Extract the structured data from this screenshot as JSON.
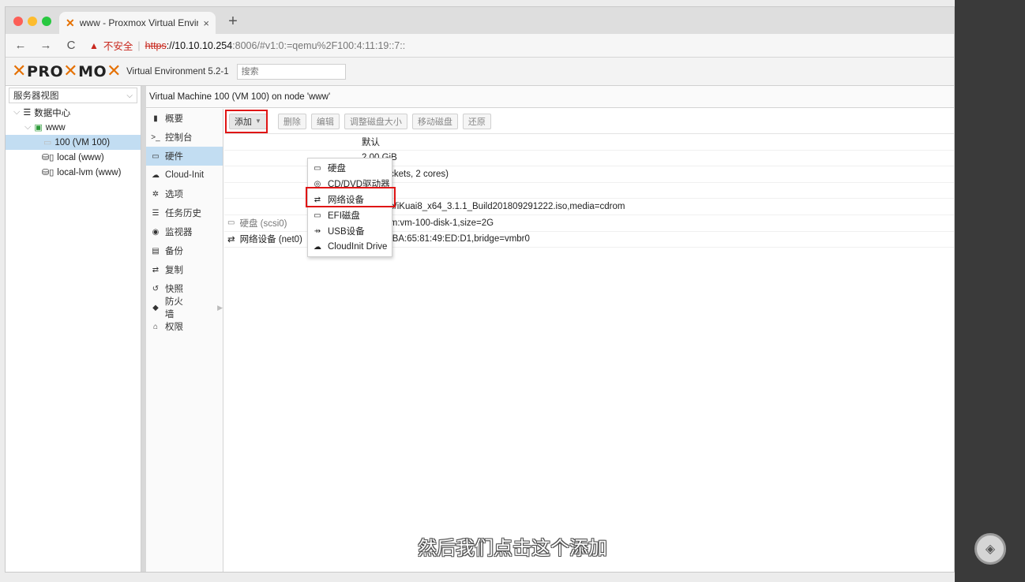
{
  "browser": {
    "tab_title": "www - Proxmox Virtual Environ",
    "tab_close": "×",
    "new_tab": "+",
    "url_security": "不安全",
    "url_scheme": "https",
    "url_host": "://10.10.10.254",
    "url_path": ":8006/#v1:0:=qemu%2F100:4:11:19::7::",
    "back": "←",
    "forward": "→",
    "reload": "C"
  },
  "header": {
    "logo_text_1": "PRO",
    "logo_text_2": "MO",
    "version": "Virtual Environment 5.2-1",
    "search_placeholder": "搜索"
  },
  "tree": {
    "view_label": "服务器视图",
    "items": [
      {
        "label": "数据中心"
      },
      {
        "label": "www"
      },
      {
        "label": "100 (VM 100)"
      },
      {
        "label": "local (www)"
      },
      {
        "label": "local-lvm (www)"
      }
    ]
  },
  "vm": {
    "title": "Virtual Machine 100 (VM 100) on node 'www'",
    "nav": [
      {
        "label": "概要",
        "icon": "book-icon"
      },
      {
        "label": "控制台",
        "icon": "terminal-icon"
      },
      {
        "label": "硬件",
        "icon": "desktop-icon"
      },
      {
        "label": "Cloud-Init",
        "icon": "cloud-icon"
      },
      {
        "label": "选项",
        "icon": "gear-icon"
      },
      {
        "label": "任务历史",
        "icon": "list-icon"
      },
      {
        "label": "监视器",
        "icon": "eye-icon"
      },
      {
        "label": "备份",
        "icon": "floppy-icon"
      },
      {
        "label": "复制",
        "icon": "retweet-icon"
      },
      {
        "label": "快照",
        "icon": "history-icon"
      },
      {
        "label": "防火墙",
        "icon": "shield-icon"
      },
      {
        "label": "权限",
        "icon": "unlock-icon"
      }
    ]
  },
  "toolbar": {
    "add": "添加",
    "remove": "删除",
    "edit": "编辑",
    "resize": "调整磁盘大小",
    "move": "移动磁盘",
    "revert": "还原"
  },
  "hardware": [
    {
      "key": "",
      "value": "默认"
    },
    {
      "key": "",
      "value": "2.00 GiB"
    },
    {
      "key": "",
      "value": "2 (1 sockets, 2 cores)"
    },
    {
      "key": "",
      "value": "默认"
    },
    {
      "key": "e2)",
      "value": "local:iso/iKuai8_x64_3.1.1_Build201809291222.iso,media=cdrom"
    },
    {
      "key": "硬盘 (scsi0)",
      "value": "local-lvm:vm-100-disk-1,size=2G"
    },
    {
      "key": "网络设备 (net0)",
      "value": "e1000=BA:65:81:49:ED:D1,bridge=vmbr0"
    }
  ],
  "dropdown": [
    {
      "label": "硬盘",
      "icon": "hdd-icon"
    },
    {
      "label": "CD/DVD驱动器",
      "icon": "cdrom-icon"
    },
    {
      "label": "网络设备",
      "icon": "exchange-icon"
    },
    {
      "label": "EFI磁盘",
      "icon": "hdd-icon"
    },
    {
      "label": "USB设备",
      "icon": "usb-icon"
    },
    {
      "label": "CloudInit Drive",
      "icon": "cloud-icon"
    }
  ],
  "subtitle": "然后我们点击这个添加",
  "colors": {
    "accent": "#e57000",
    "selection": "#c2ddf2",
    "highlight": "#e01515"
  }
}
